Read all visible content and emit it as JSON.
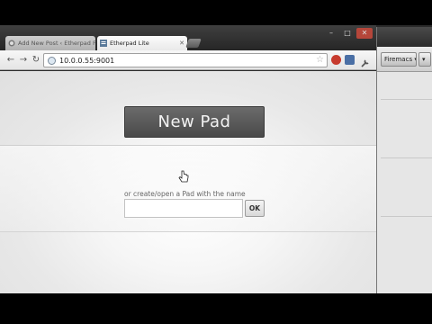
{
  "background_window": {
    "button_label": "Firemacs",
    "button_arrow": "▾"
  },
  "browser": {
    "tabs": [
      {
        "label": "Add New Post ‹ Etherpad Fi",
        "favicon": "wordpress-icon",
        "active": false
      },
      {
        "label": "Etherpad Lite",
        "favicon": "etherpad-icon",
        "active": true
      }
    ],
    "window_controls": {
      "minimize": "–",
      "maximize": "□",
      "close": "✕"
    },
    "nav": {
      "back": "←",
      "forward": "→",
      "reload": "↻"
    },
    "address": {
      "url": "10.0.0.55:9001"
    },
    "colors": {
      "titlebar": "#2c2c2c",
      "page_bg": "#ededed",
      "button_dark": "#555555"
    }
  },
  "page": {
    "new_pad_label": "New Pad",
    "or_label": "or create/open a Pad with the name",
    "pad_name_value": "",
    "ok_label": "OK"
  }
}
